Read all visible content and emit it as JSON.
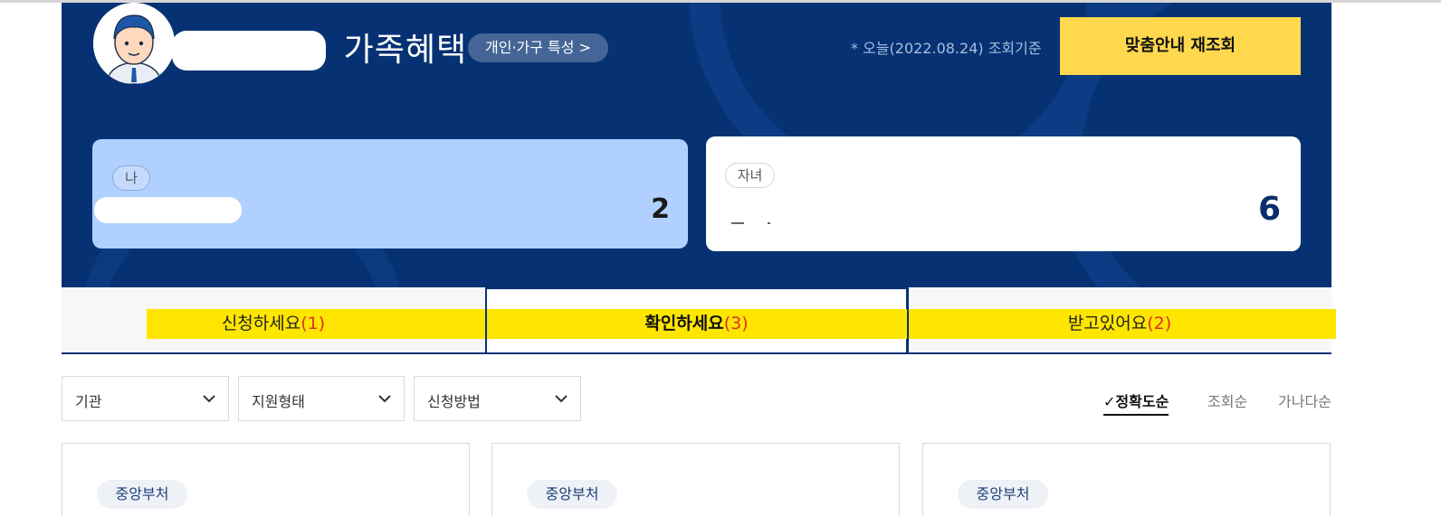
{
  "header": {
    "title": "가족혜택",
    "profile_button": "개인·가구 특성 >",
    "date_note": "* 오늘(2022.08.24) 조회기준",
    "reload_button": "맞춤안내 재조회"
  },
  "family_cards": [
    {
      "tag": "나",
      "count": "2"
    },
    {
      "tag": "자녀",
      "count": "6"
    }
  ],
  "tabs": [
    {
      "label": "신청하세요",
      "count": "(1)",
      "active": false
    },
    {
      "label": "확인하세요",
      "count": "(3)",
      "active": true
    },
    {
      "label": "받고있어요",
      "count": "(2)",
      "active": false
    }
  ],
  "filters": [
    {
      "label": "기관"
    },
    {
      "label": "지원형태"
    },
    {
      "label": "신청방법"
    }
  ],
  "sort": {
    "active_check": "✓",
    "options": [
      "정확도순",
      "조회순",
      "가나다순"
    ]
  },
  "result_cards": [
    {
      "badge": "중앙부처"
    },
    {
      "badge": "중앙부처"
    },
    {
      "badge": "중앙부처"
    }
  ],
  "colors": {
    "hero_bg": "#063273",
    "accent_yellow": "#ffd84d",
    "highlight": "#ffe600",
    "count_red": "#e0301e"
  }
}
